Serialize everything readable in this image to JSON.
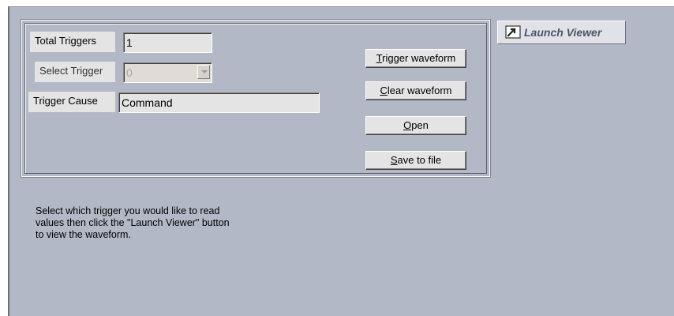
{
  "form": {
    "total_triggers": {
      "label": "Total Triggers",
      "value": "1"
    },
    "select_trigger": {
      "label": "Select Trigger",
      "value": "0"
    },
    "trigger_cause": {
      "label": "Trigger Cause",
      "value": "Command"
    }
  },
  "buttons": {
    "trigger_waveform": {
      "mnemonic": "T",
      "rest": "rigger waveform"
    },
    "clear_waveform": {
      "mnemonic": "C",
      "rest": "lear waveform"
    },
    "open": {
      "mnemonic": "O",
      "rest": "pen"
    },
    "save_to_file": {
      "mnemonic": "S",
      "rest": "ave to file"
    }
  },
  "launch_viewer": {
    "label": "Launch Viewer",
    "icon": "launch-arrow-icon"
  },
  "help": {
    "line1": "Select which trigger you would like to read",
    "line2": "values then click the \"Launch Viewer\" button",
    "line3": "to view the waveform."
  },
  "colors": {
    "panel_bg": "#b2b8c6",
    "control_bg": "#e4e4e4",
    "launch_text": "#4d5566"
  }
}
